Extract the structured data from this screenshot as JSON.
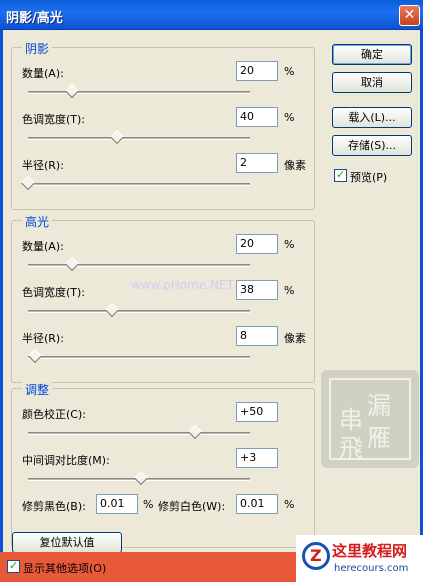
{
  "window": {
    "title": "阴影/高光",
    "close_glyph": "✕"
  },
  "buttons": {
    "ok": "确定",
    "cancel": "取消",
    "load": "载入(L)...",
    "save": "存储(S)...",
    "reset": "复位默认值"
  },
  "preview": {
    "label": "预览(P)",
    "checked": true
  },
  "show_more": {
    "label": "显示其他选项(O)",
    "checked": true
  },
  "shadows": {
    "title": "阴影",
    "amount": {
      "label": "数量(A):",
      "value": "20",
      "unit": "%",
      "slider_fraction": 0.2
    },
    "tonal_width": {
      "label": "色调宽度(T):",
      "value": "40",
      "unit": "%",
      "slider_fraction": 0.4
    },
    "radius": {
      "label": "半径(R):",
      "value": "2",
      "unit": "像素",
      "slider_fraction": 0.0
    }
  },
  "highlights": {
    "title": "高光",
    "amount": {
      "label": "数量(A):",
      "value": "20",
      "unit": "%",
      "slider_fraction": 0.2
    },
    "tonal_width": {
      "label": "色调宽度(T):",
      "value": "38",
      "unit": "%",
      "slider_fraction": 0.38
    },
    "radius": {
      "label": "半径(R):",
      "value": "8",
      "unit": "像素",
      "slider_fraction": 0.03
    }
  },
  "adjustments": {
    "title": "调整",
    "color_correction": {
      "label": "颜色校正(C):",
      "value": "+50",
      "slider_fraction": 0.75
    },
    "midtone_contrast": {
      "label": "中间调对比度(M):",
      "value": "+3",
      "slider_fraction": 0.51
    },
    "clip_black": {
      "label": "修剪黑色(B):",
      "value": "0.01",
      "unit": "%"
    },
    "clip_white": {
      "label": "修剪白色(W):",
      "value": "0.01",
      "unit": "%"
    }
  },
  "watermarks": {
    "site_text": "www.pHome.NET",
    "logo_title": "这里教程网",
    "logo_sub": "herecours.com"
  },
  "colors": {
    "title_bar": "#0a5fd8",
    "group_title": "#0046d5",
    "footer": "#e8593a"
  }
}
